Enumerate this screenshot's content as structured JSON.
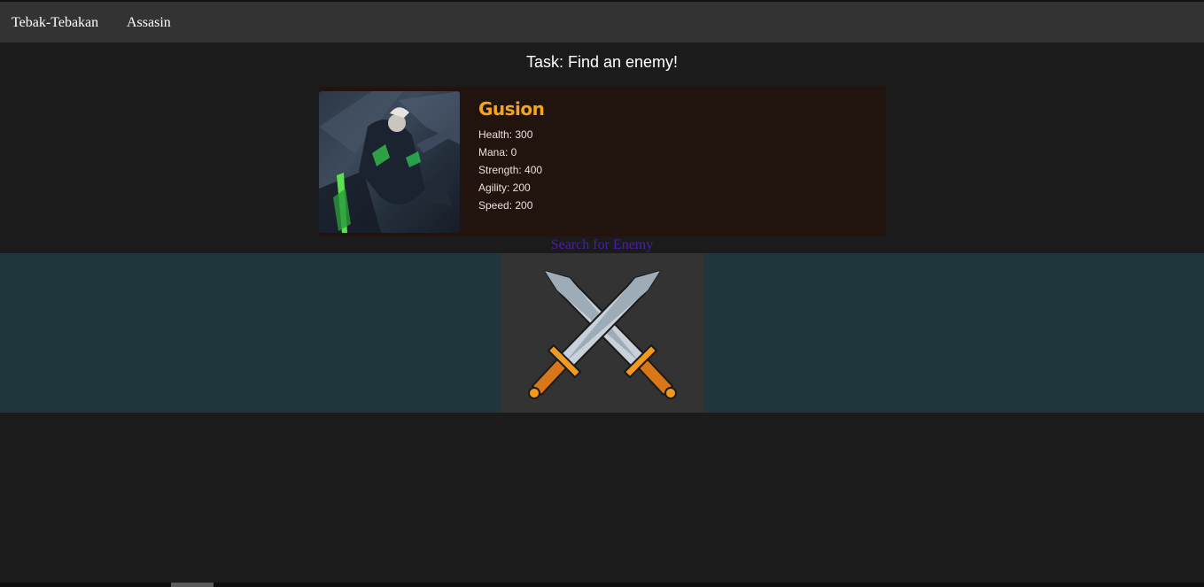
{
  "nav": {
    "links": [
      "Tebak-Tebakan",
      "Assasin"
    ]
  },
  "task": {
    "title": "Task: Find an enemy!"
  },
  "hero": {
    "name": "Gusion",
    "stats": [
      "Health: 300",
      "Mana: 0",
      "Strength: 400",
      "Agility: 200",
      "Speed: 200"
    ]
  },
  "search": {
    "label": "Search for Enemy"
  },
  "battle": {
    "icon": "crossed-swords-icon"
  },
  "colors": {
    "nav_bg": "#333333",
    "page_bg": "#1b1b1b",
    "hero_name": "#f5a51a",
    "search_link": "#4a1fa6",
    "battle_band": "#1f363c"
  }
}
